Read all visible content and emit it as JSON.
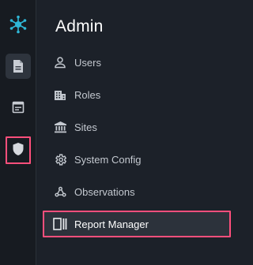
{
  "rail": {
    "items": [
      {
        "name": "app-logo",
        "icon": "hub-network-icon"
      },
      {
        "name": "reports",
        "icon": "document-icon",
        "active": true
      },
      {
        "name": "forms",
        "icon": "form-window-icon"
      },
      {
        "name": "admin",
        "icon": "shield-icon",
        "highlighted": true
      }
    ]
  },
  "panel": {
    "title": "Admin",
    "items": [
      {
        "label": "Users",
        "icon": "user-icon"
      },
      {
        "label": "Roles",
        "icon": "building-icon"
      },
      {
        "label": "Sites",
        "icon": "bank-icon"
      },
      {
        "label": "System Config",
        "icon": "gear-icon"
      },
      {
        "label": "Observations",
        "icon": "webhook-icon"
      },
      {
        "label": "Report Manager",
        "icon": "report-panel-icon",
        "highlighted": true
      }
    ]
  },
  "colors": {
    "background": "#1c2129",
    "rail": "#171b21",
    "accent_logo": "#2fb7d6",
    "highlight": "#ff4f7c",
    "text": "#c3c8cf",
    "title": "#ffffff"
  }
}
